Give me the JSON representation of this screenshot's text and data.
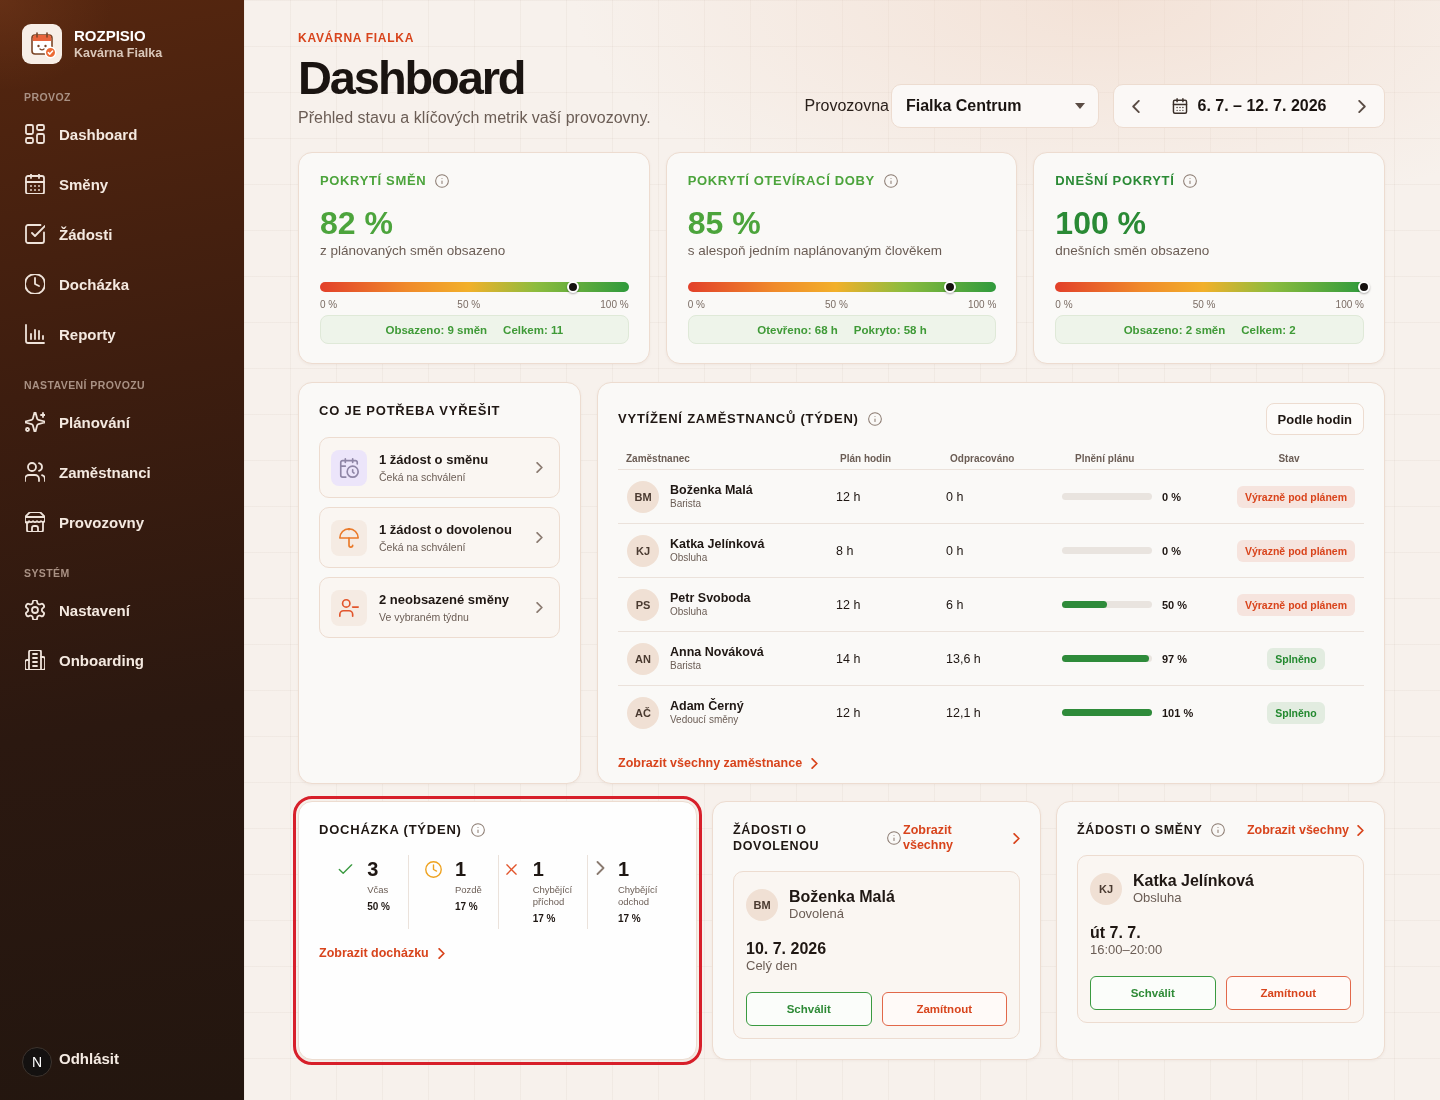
{
  "sidebar": {
    "brand": {
      "name": "ROZPISIO",
      "subtitle": "Kavárna Fialka"
    },
    "sections": [
      {
        "label": "PROVOZ",
        "items": [
          {
            "label": "Dashboard",
            "selected": false
          },
          {
            "label": "Směny",
            "selected": false
          },
          {
            "label": "Žádosti",
            "selected": false
          },
          {
            "label": "Docházka",
            "selected": false
          },
          {
            "label": "Reporty",
            "selected": false
          }
        ]
      },
      {
        "label": "NASTAVENÍ PROVOZU",
        "items": [
          {
            "label": "Plánování",
            "selected": false
          },
          {
            "label": "Zaměstnanci",
            "selected": false
          },
          {
            "label": "Provozovny",
            "selected": false
          }
        ]
      },
      {
        "label": "SYSTÉM",
        "items": [
          {
            "label": "Nastavení",
            "selected": false
          },
          {
            "label": "Onboarding",
            "selected": false
          }
        ]
      }
    ],
    "logout": {
      "badge": "N",
      "label": "Odhlásit"
    }
  },
  "header": {
    "eyebrow": "KAVÁRNA FIALKA",
    "title": "Dashboard",
    "subtitle": "Přehled stavu a klíčových metrik vaší provozovny.",
    "location_label": "Provozovna",
    "location_value": "Fialka Centrum",
    "date_range": "6. 7. – 12. 7. 2026"
  },
  "kpis": [
    {
      "title": "POKRYTÍ SMĚN",
      "value": "82 %",
      "caption": "z plánovaných směn obsazeno",
      "level": 0.82,
      "scale": [
        "0 %",
        "50 %",
        "100 %"
      ],
      "stats": [
        "Obsazeno: 9 směn",
        "Celkem: 11"
      ]
    },
    {
      "title": "POKRYTÍ OTEVÍRACÍ DOBY",
      "value": "85 %",
      "caption": "s alespoň jedním naplánovaným člověkem",
      "level": 0.85,
      "scale": [
        "0 %",
        "50 %",
        "100 %"
      ],
      "stats": [
        "Otevřeno: 68 h",
        "Pokryto: 58 h"
      ]
    },
    {
      "title": "DNEŠNÍ POKRYTÍ",
      "value": "100 %",
      "caption": "dnešních směn obsazeno",
      "level": 1.0,
      "scale": [
        "0 %",
        "50 %",
        "100 %"
      ],
      "stats": [
        "Obsazeno: 2 směn",
        "Celkem: 2"
      ]
    }
  ],
  "todo": {
    "title": "CO JE POTŘEBA VYŘEŠIT",
    "items": [
      {
        "kind": "shift_request",
        "title": "1 žádost o směnu",
        "subtitle": "Čeká na schválení"
      },
      {
        "kind": "vacation_request",
        "title": "1 žádost o dovolenou",
        "subtitle": "Čeká na schválení"
      },
      {
        "kind": "unfilled_shifts",
        "title": "2 neobsazené směny",
        "subtitle": "Ve vybraném týdnu"
      }
    ]
  },
  "workload": {
    "title": "VYTÍŽENÍ ZAMĚSTNANCŮ (TÝDEN)",
    "sort_button": "Podle hodin",
    "columns": [
      "Zaměstnanec",
      "Plán hodin",
      "Odpracováno",
      "Plnění plánu",
      "Stav"
    ],
    "rows": [
      {
        "initials": "BM",
        "name": "Boženka Malá",
        "role": "Barista",
        "planned": "12 h",
        "worked": "0 h",
        "level": 0,
        "percent": "0 %",
        "status": "Výrazně pod plánem",
        "color": "#d9441c"
      },
      {
        "initials": "KJ",
        "name": "Katka Jelínková",
        "role": "Obsluha",
        "planned": "8 h",
        "worked": "0 h",
        "level": 0,
        "percent": "0 %",
        "status": "Výrazně pod plánem",
        "color": "#d9441c"
      },
      {
        "initials": "PS",
        "name": "Petr Svoboda",
        "role": "Obsluha",
        "planned": "12 h",
        "worked": "6 h",
        "level": 0.5,
        "percent": "50 %",
        "status": "Výrazně pod plánem",
        "color": "#d9441c"
      },
      {
        "initials": "AN",
        "name": "Anna Nováková",
        "role": "Barista",
        "planned": "14 h",
        "worked": "13,6 h",
        "level": 0.97,
        "percent": "97 %",
        "status": "Splněno",
        "color": "#23892f"
      },
      {
        "initials": "AČ",
        "name": "Adam Černý",
        "role": "Vedoucí směny",
        "planned": "12 h",
        "worked": "12,1 h",
        "level": 1.0,
        "percent": "101 %",
        "status": "Splněno",
        "color": "#23892f"
      }
    ],
    "link": "Zobrazit všechny zaměstnance"
  },
  "attendance": {
    "title": "DOCHÁZKA (TÝDEN)",
    "highlighted": true,
    "stats": [
      {
        "kind": "on_time",
        "count": "3",
        "label": "Včas",
        "percent": "50 %"
      },
      {
        "kind": "late",
        "count": "1",
        "label": "Pozdě",
        "percent": "17 %"
      },
      {
        "kind": "missing_in",
        "count": "1",
        "label": "Chybějící příchod",
        "percent": "17 %"
      },
      {
        "kind": "missing_out",
        "count": "1",
        "label": "Chybějící odchod",
        "percent": "17 %"
      }
    ],
    "link": "Zobrazit docházku"
  },
  "vacation_requests": {
    "title": "ŽÁDOSTI O DOVOLENOU",
    "link": "Zobrazit všechny",
    "request": {
      "initials": "BM",
      "name": "Boženka Malá",
      "type": "Dovolená",
      "date": "10. 7. 2026",
      "time": "Celý den",
      "approve": "Schválit",
      "reject": "Zamítnout"
    }
  },
  "shift_requests": {
    "title": "ŽÁDOSTI O SMĚNY",
    "link": "Zobrazit všechny",
    "request": {
      "initials": "KJ",
      "name": "Katka Jelínková",
      "type": "Obsluha",
      "date": "út 7. 7.",
      "time": "16:00–20:00",
      "approve": "Schválit",
      "reject": "Zamítnout"
    }
  }
}
